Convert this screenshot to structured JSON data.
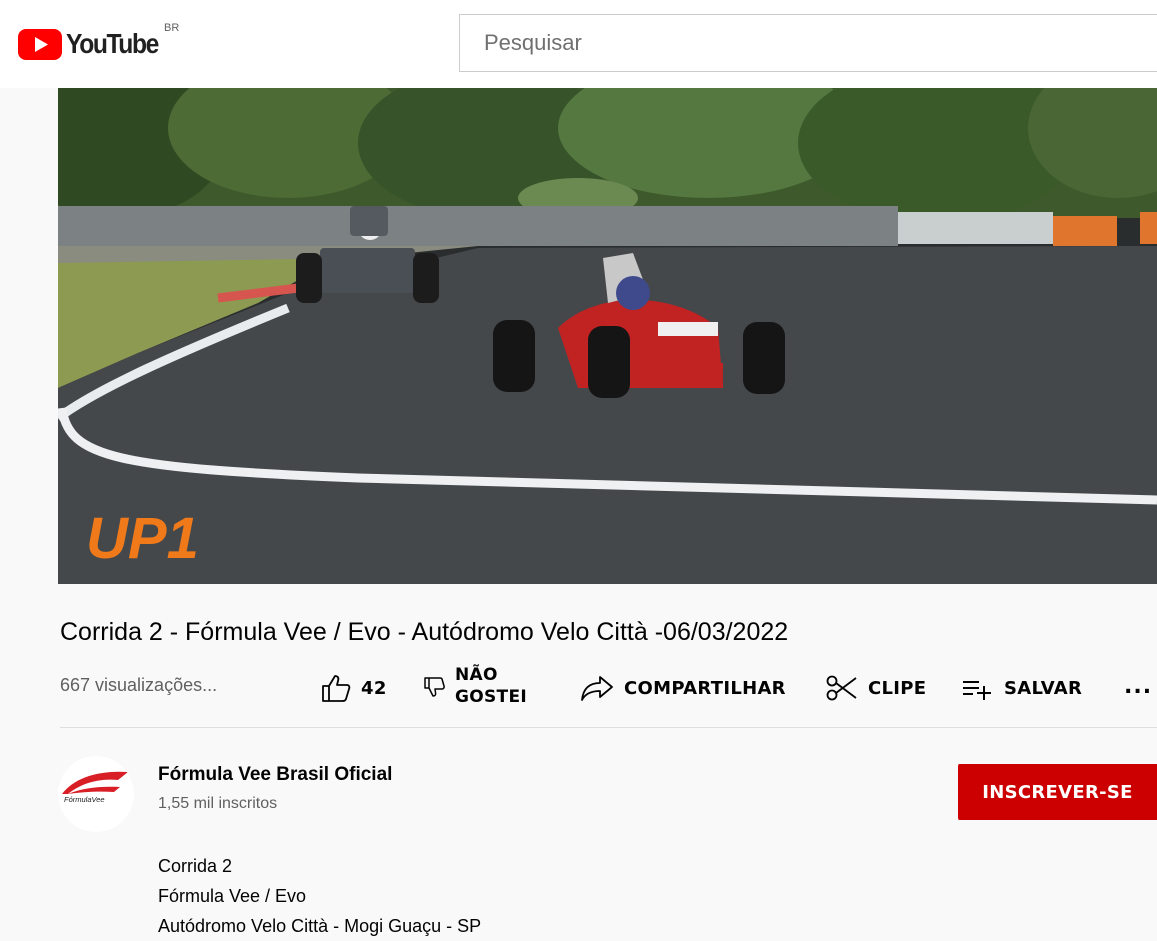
{
  "header": {
    "logo_text": "YouTube",
    "country_code": "BR",
    "search_placeholder": "Pesquisar"
  },
  "player": {
    "watermark_text": "UP1"
  },
  "video": {
    "title": "Corrida 2 - Fórmula Vee / Evo - Autódromo Velo Città -06/03/2022",
    "views": "667 visualizações...",
    "like_count": "42",
    "dislike_label_line1": "NÃO",
    "dislike_label_line2": "GOSTEI",
    "share_label": "COMPARTILHAR",
    "clip_label": "CLIPE",
    "save_label": "SALVAR",
    "more_label": "..."
  },
  "channel": {
    "name": "Fórmula Vee Brasil Oficial",
    "subscribers": "1,55 mil inscritos",
    "subscribe_label": "INSCREVER-SE",
    "avatar_logo_text": "FórmulaVee"
  },
  "description": {
    "lines": [
      "Corrida 2",
      "Fórmula Vee / Evo",
      "Autódromo Velo Città - Mogi Guaçu - SP"
    ]
  },
  "colors": {
    "brand_red": "#ff0000",
    "subscribe_red": "#cc0000",
    "secondary_text": "#606060"
  },
  "icons": [
    "youtube-logo-icon",
    "like-icon",
    "dislike-icon",
    "share-icon",
    "clip-icon",
    "save-playlist-icon",
    "more-icon"
  ]
}
